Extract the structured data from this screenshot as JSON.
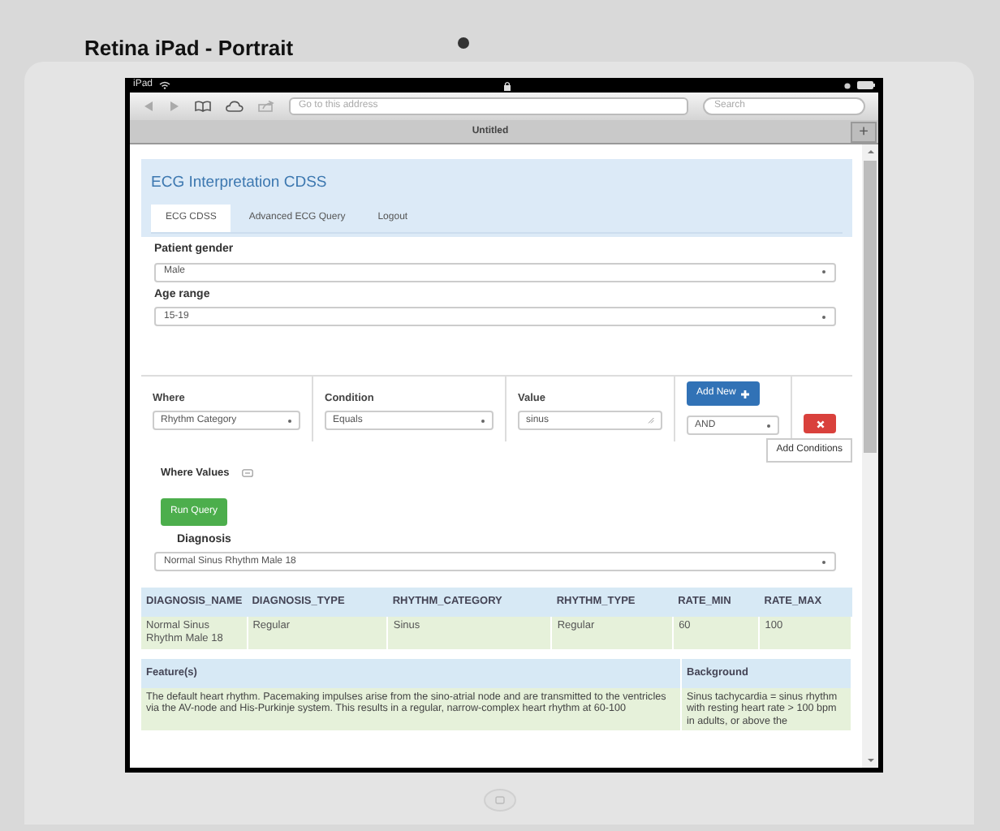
{
  "simulator_title": "Retina iPad - Portrait",
  "status_bar": {
    "carrier": "iPad"
  },
  "browser": {
    "address_placeholder": "Go to this address",
    "search_placeholder": "Search",
    "tab_title": "Untitled",
    "new_tab": "+"
  },
  "page": {
    "title": "ECG Interpretation CDSS",
    "tabs": [
      {
        "label": "ECG CDSS",
        "selected": true
      },
      {
        "label": "Advanced ECG Query",
        "selected": false
      },
      {
        "label": "Logout",
        "selected": false
      }
    ],
    "fields": [
      {
        "label": "Patient gender",
        "value": "Male"
      },
      {
        "label": "Age range",
        "value": "15-19"
      }
    ],
    "conditions": {
      "columns": [
        "Where",
        "Condition",
        "Value"
      ],
      "add_button": "Add New",
      "rows": [
        {
          "where": "Rhythm Category",
          "condition": "Equals",
          "value": "sinus",
          "connector": "AND"
        }
      ],
      "add_conditions": "Add Conditions"
    },
    "where_values": "Where Values",
    "run_button": "Run Query",
    "diagnosis": {
      "label": "Diagnosis",
      "value": "Normal Sinus Rhythm Male 18"
    },
    "results": {
      "columns": [
        "DIAGNOSIS_NAME",
        "DIAGNOSIS_TYPE",
        "RHYTHM_CATEGORY",
        "RHYTHM_TYPE",
        "RATE_MIN",
        "RATE_MAX"
      ],
      "rows": [
        [
          "Normal Sinus Rhythm Male 18",
          "Regular",
          "Sinus",
          "Regular",
          "60",
          "100"
        ]
      ]
    },
    "features": {
      "columns": [
        "Feature(s)",
        "Background"
      ],
      "rows": [
        [
          "The default heart rhythm. Pacemaking impulses arise from the sino-atrial node and are transmitted to the ventricles via the AV-node and His-Purkinje system. This results in a regular, narrow-complex heart rhythm at 60-100",
          "Sinus tachycardia = sinus rhythm with resting heart rate > 100 bpm in adults, or above the"
        ]
      ]
    }
  }
}
